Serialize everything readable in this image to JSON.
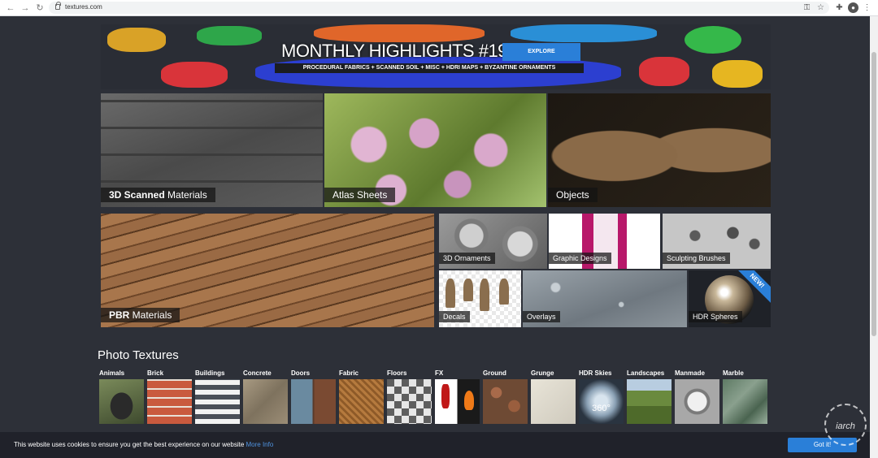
{
  "browser": {
    "url": "textures.com"
  },
  "banner": {
    "title": "MONTHLY HIGHLIGHTS #19",
    "subtitle": "PROCEDURAL FABRICS + SCANNED SOIL + MISC + HDRI MAPS + BYZANTINE ORNAMENTS",
    "button": "EXPLORE"
  },
  "tiles": {
    "scanned": {
      "bold": "3D Scanned",
      "rest": " Materials"
    },
    "atlas": "Atlas Sheets",
    "objects": "Objects",
    "pbr": {
      "bold": "PBR",
      "rest": " Materials"
    },
    "ornaments": "3D Ornaments",
    "graphic": "Graphic Designs",
    "sculpt": "Sculpting Brushes",
    "decals": "Decals",
    "overlays": "Overlays",
    "hdr": "HDR Spheres",
    "new_badge": "NEW!"
  },
  "photo_textures": {
    "title": "Photo Textures",
    "categories": [
      "Animals",
      "Brick",
      "Buildings",
      "Concrete",
      "Doors",
      "Fabric",
      "Floors",
      "FX",
      "Ground",
      "Grunge",
      "HDR Skies",
      "Landscapes",
      "Manmade",
      "Marble"
    ],
    "hdr_sky_badge": "360°"
  },
  "cookie": {
    "text": "This website uses cookies to ensure you get the best experience on our website ",
    "more": "More Info",
    "button": "Got it!"
  },
  "watermark": "iarch",
  "colors": {
    "accent": "#2a7fd8",
    "page_bg": "#2d3038",
    "cookie_bg": "#20222a"
  }
}
